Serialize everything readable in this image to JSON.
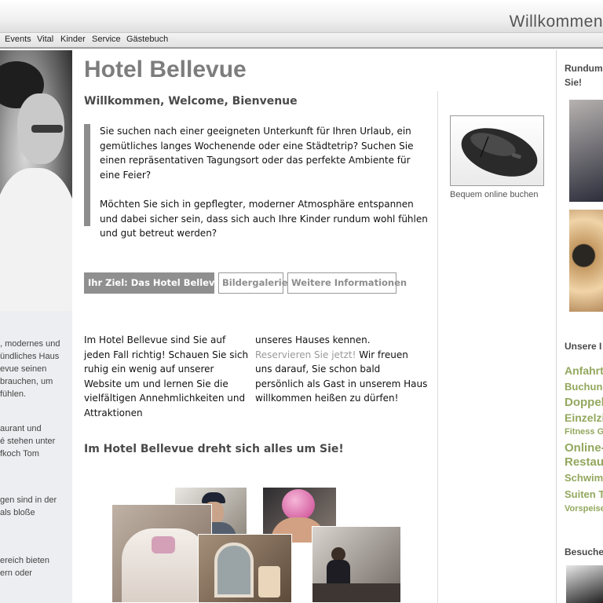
{
  "header": {
    "welcome": "Willkommen"
  },
  "nav": {
    "items": [
      "Events",
      "Vital",
      "Kinder",
      "Service",
      "Gästebuch"
    ]
  },
  "left_sidebar": {
    "text_lines": [
      ", modernes und",
      "ündliches Haus",
      "evue seinen",
      " brauchen, um",
      "fühlen.",
      "aurant und",
      "é stehen unter",
      "fkoch Tom",
      "gen sind in der",
      "als bloße",
      "ereich bieten",
      "ern oder"
    ]
  },
  "main": {
    "title": "Hotel Bellevue",
    "subtitle": "Willkommen, Welcome, Bienvenue",
    "intro_paragraphs": [
      "Sie suchen nach einer geeigneten Unterkunft für Ihren Urlaub, ein gemütliches langes Wochenende oder eine Städtetrip? Suchen Sie einen repräsentativen Tagungsort oder das perfekte Ambiente für eine Feier?",
      "Möchten Sie sich in gepflegter, moderner Atmosphäre entspannen und dabei sicher sein, dass sich auch Ihre Kinder rundum wohl fühlen und gut betreut werden?"
    ],
    "tabs": [
      {
        "label": "Ihr Ziel: Das Hotel Bellevue",
        "active": true
      },
      {
        "label": "Bildergalerie",
        "active": false
      },
      {
        "label": "Weitere Informationen",
        "active": false
      }
    ],
    "body_left": "Im Hotel Bellevue sind Sie auf jeden Fall richtig! Schauen Sie sich ruhig ein wenig auf unserer Website um und lernen Sie die vielfältigen Annehmlichkeiten und Attraktionen",
    "body_right_before": "unseres Hauses kennen. ",
    "body_right_link": "Reservieren Sie jetzt!",
    "body_right_after": " Wir freuen uns darauf, Sie schon bald persönlich als Gast in unserem Haus willkommen heißen zu dürfen!",
    "section_heading": "Im Hotel Bellevue dreht sich alles um Sie!"
  },
  "booking": {
    "caption": "Bequem online buchen"
  },
  "right_sidebar": {
    "heading_top_lines": [
      "Rundum",
      "Sie!"
    ],
    "heading_mid": "Unsere I",
    "links": [
      {
        "label": "Anfahrt",
        "size": 14
      },
      {
        "label": "Buchung",
        "size": 13
      },
      {
        "label": "Doppel",
        "size": 15
      },
      {
        "label": "Einzelzi",
        "size": 14
      },
      {
        "label": "Fitness G",
        "size": 11
      },
      {
        "label": "Online-",
        "size": 15
      },
      {
        "label": "Restau",
        "size": 15
      },
      {
        "label": "Schwimr",
        "size": 13
      },
      {
        "label": "Suiten T",
        "size": 13
      },
      {
        "label": "Vorspeise",
        "size": 11
      }
    ],
    "heading_bottom": "Besuche"
  },
  "colors": {
    "accent_green": "#93a85e",
    "gray_text": "#7d7d7d",
    "tab_active_bg": "#8f8f8f"
  }
}
